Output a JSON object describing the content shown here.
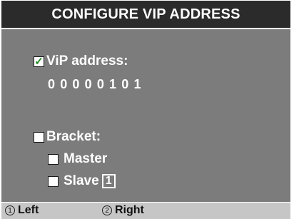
{
  "title": "CONFIGURE VIP ADDRESS",
  "vip": {
    "checked": true,
    "check_glyph": "✓",
    "label": "ViP address:",
    "value": "00000101"
  },
  "bracket": {
    "checked": false,
    "label": "Bracket:"
  },
  "master": {
    "checked": false,
    "label": "Master"
  },
  "slave": {
    "checked": false,
    "label": "Slave",
    "number": "1"
  },
  "footer": {
    "left_num": "1",
    "left_label": "Left",
    "right_num": "2",
    "right_label": "Right"
  },
  "colors": {
    "title_bg": "#2b2b2b",
    "panel_bg": "#7c7c7c",
    "footer_bg": "#c6c6c6",
    "check_green": "#1f8a1f"
  }
}
